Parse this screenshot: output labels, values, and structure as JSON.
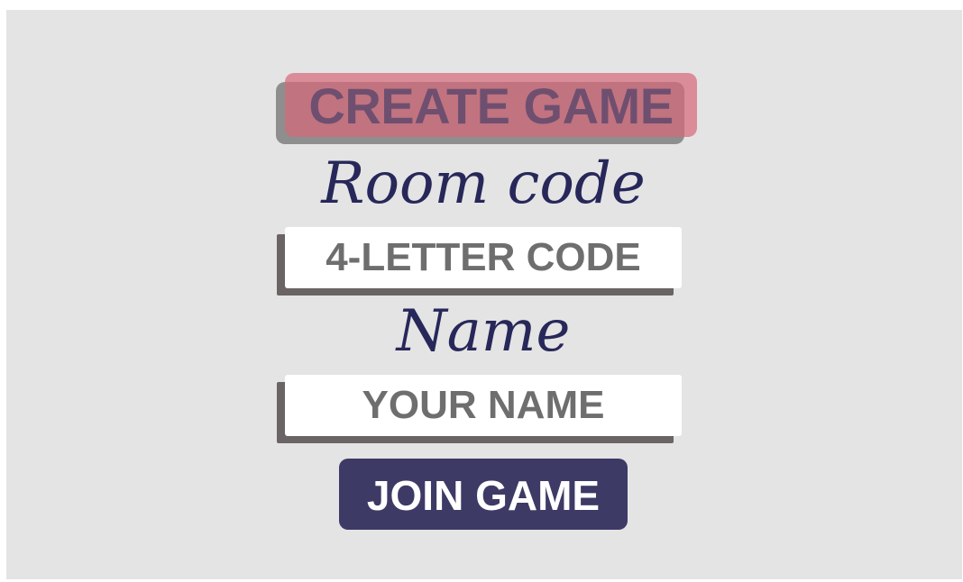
{
  "create_button": {
    "label": "CREATE GAME"
  },
  "room_code": {
    "label": "Room code",
    "placeholder": "4-LETTER CODE",
    "value": ""
  },
  "name": {
    "label": "Name",
    "placeholder": "YOUR NAME",
    "value": ""
  },
  "join_button": {
    "label": "JOIN GAME"
  },
  "colors": {
    "background": "#e4e4e4",
    "create_button": "#d66a7c",
    "join_button": "#3d3a66",
    "label_text": "#27275a",
    "placeholder_text": "#6e6e6e"
  }
}
